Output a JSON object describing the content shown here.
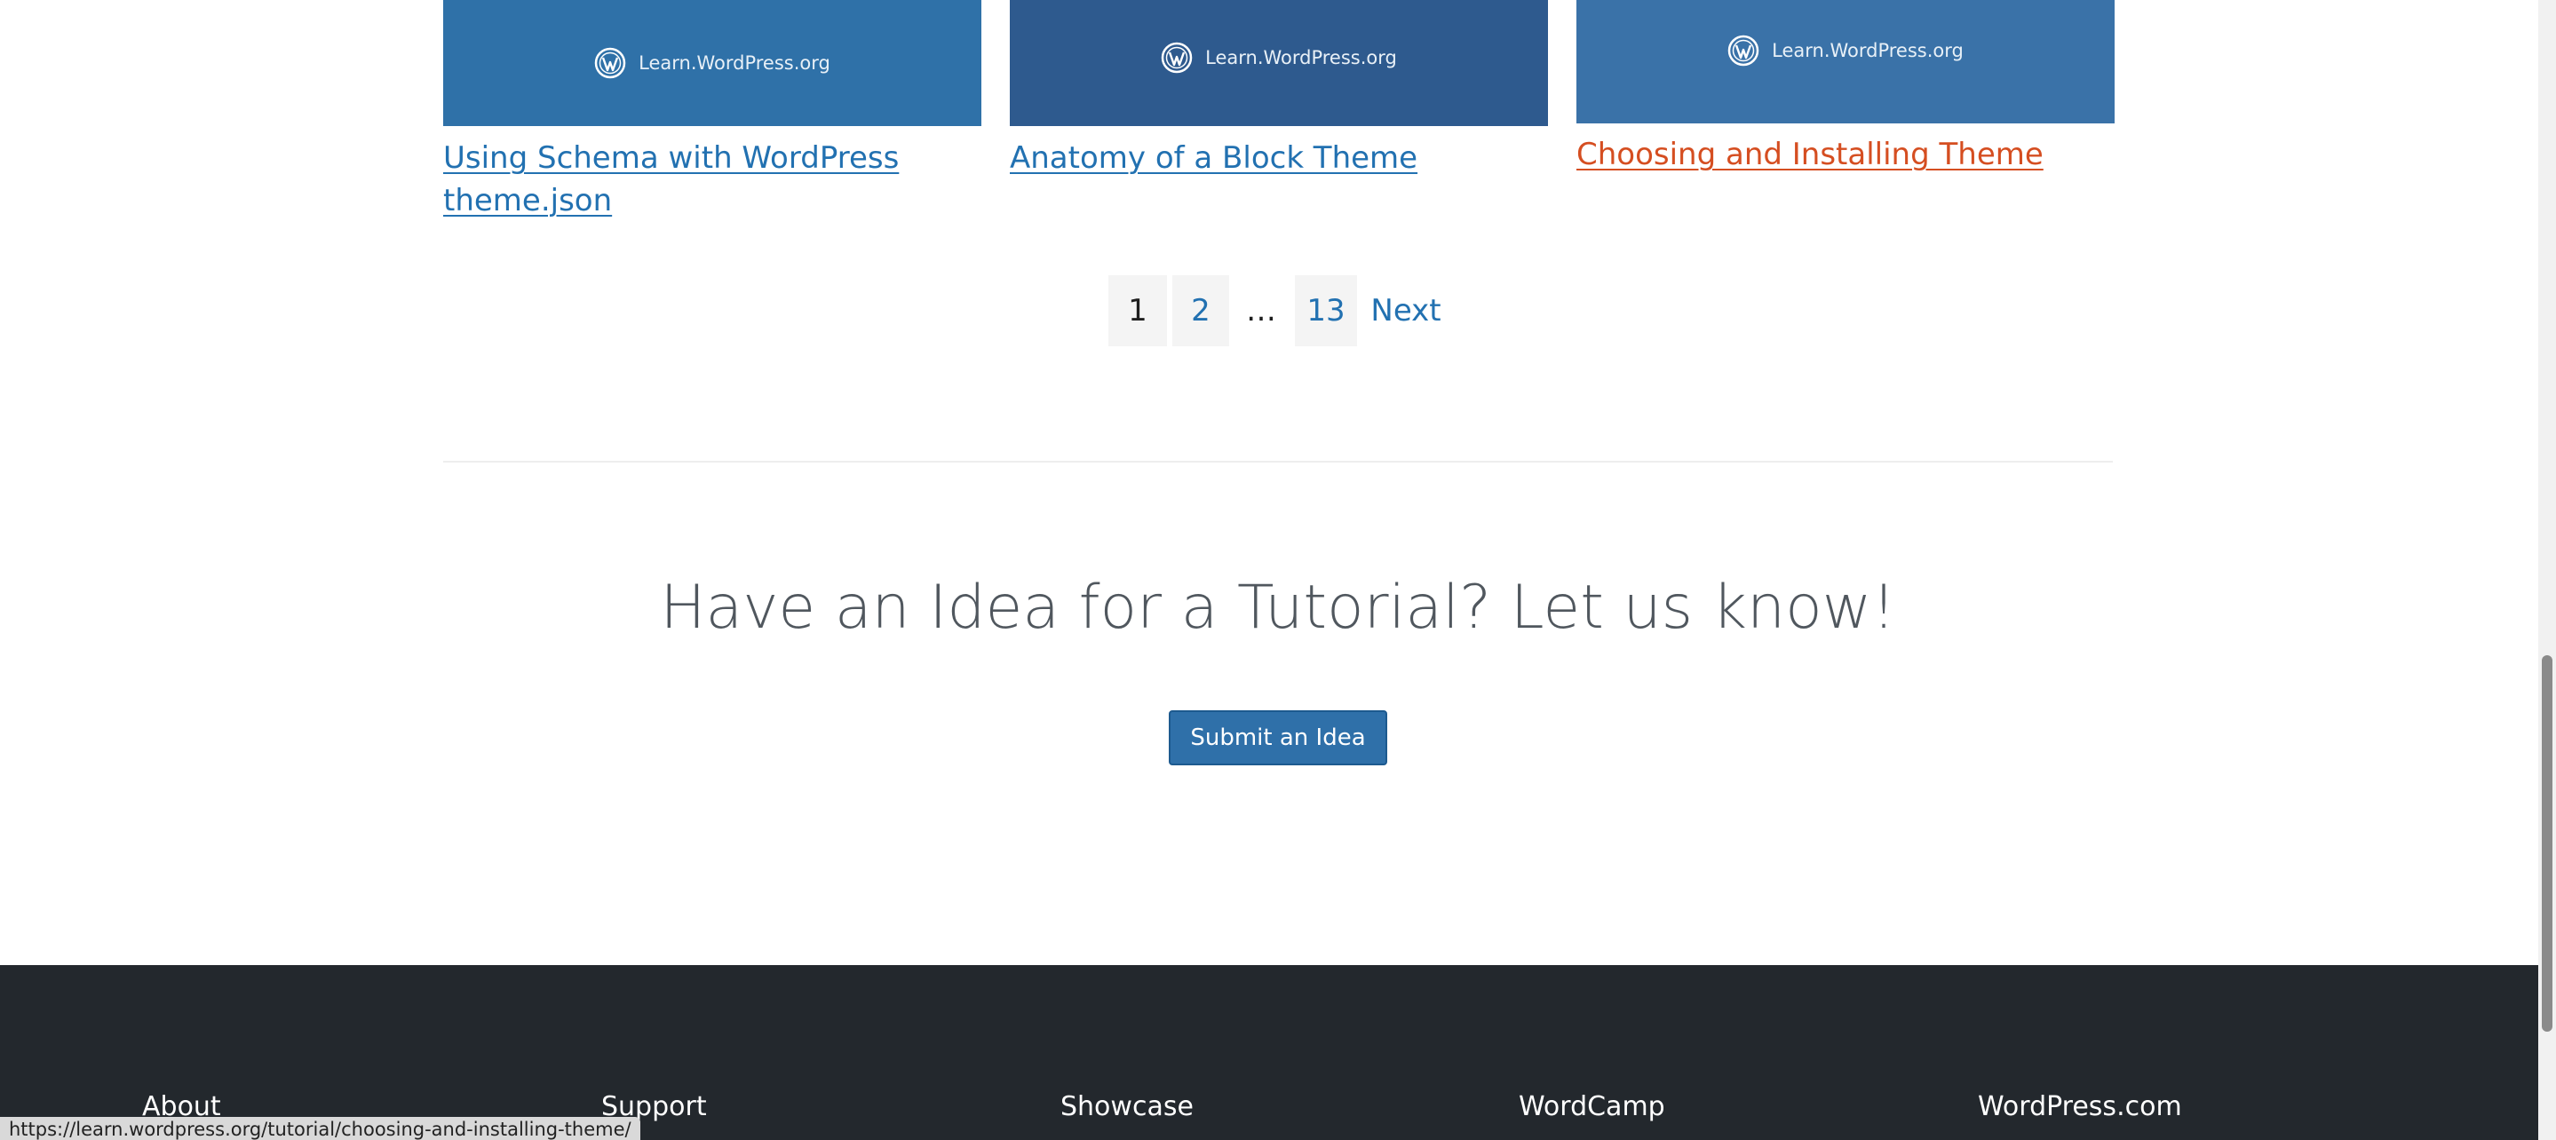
{
  "cards": [
    {
      "thumb_text": "Learn.WordPress.org",
      "title_line1": "Using Schema with WordPress",
      "title_line2": "theme.json",
      "thumb_color": "#2f71a8"
    },
    {
      "thumb_text": "Learn.WordPress.org",
      "title_line1": "Anatomy of a Block Theme",
      "thumb_color": "#2e5a8e"
    },
    {
      "thumb_text": "Learn.WordPress.org",
      "title_line1": "Choosing and Installing Theme",
      "thumb_color": "#3a72a8"
    }
  ],
  "pagination": {
    "current": "1",
    "page2": "2",
    "ellipsis": "…",
    "last": "13",
    "next": "Next"
  },
  "cta": {
    "heading": "Have an Idea for a Tutorial? Let us know!",
    "button": "Submit an Idea"
  },
  "footer": {
    "links": [
      "About",
      "Support",
      "Showcase",
      "WordCamp",
      "WordPress.com"
    ]
  },
  "status_bar": {
    "url": "https://learn.wordpress.org/tutorial/choosing-and-installing-theme/"
  },
  "colors": {
    "link": "#2271b1",
    "visited_link": "#d54e21",
    "footer_bg": "#23282d",
    "button_bg": "#2f70a9"
  }
}
